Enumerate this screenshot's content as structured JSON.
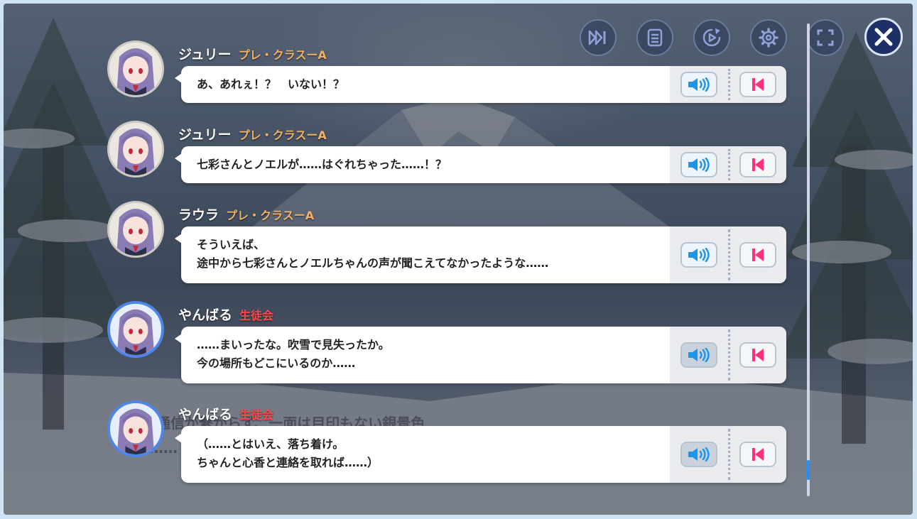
{
  "colors": {
    "affiliation_class": "#f2b068",
    "affiliation_council": "#ff4a4a",
    "close_button": "#1c2f66",
    "voice_icon": "#1f95e8",
    "jump_icon": "#ff2f7a",
    "scroll_thumb": "#1e90ff"
  },
  "toolbar": {
    "icons": [
      "skip-icon",
      "log-icon",
      "auto-play-icon",
      "settings-icon",
      "fullscreen-icon",
      "close-icon"
    ]
  },
  "background": {
    "text_line1": "通信が繋がらず、一面は目印もない銀景色",
    "text_line2": "……"
  },
  "log": {
    "entries": [
      {
        "speaker": "ジュリー",
        "affiliation": "プレ・クラスーA",
        "affiliation_type": "class",
        "lines": [
          "あ、あれぇ！？　いない！？"
        ]
      },
      {
        "speaker": "ジュリー",
        "affiliation": "プレ・クラスーA",
        "affiliation_type": "class",
        "lines": [
          "七彩さんとノエルが……はぐれちゃった……！？"
        ]
      },
      {
        "speaker": "ラウラ",
        "affiliation": "プレ・クラスーA",
        "affiliation_type": "class",
        "lines": [
          "そういえば、",
          "途中から七彩さんとノエルちゃんの声が聞こえてなかったような……"
        ]
      },
      {
        "speaker": "やんばる",
        "affiliation": "生徒会",
        "affiliation_type": "council",
        "lines": [
          "……まいったな。吹雪で見失ったか。",
          "今の場所もどこにいるのか……"
        ]
      },
      {
        "speaker": "やんばる",
        "affiliation": "生徒会",
        "affiliation_type": "council",
        "lines": [
          "（……とはいえ、落ち着け。",
          "ちゃんと心香と連絡を取れば……）"
        ]
      }
    ]
  }
}
